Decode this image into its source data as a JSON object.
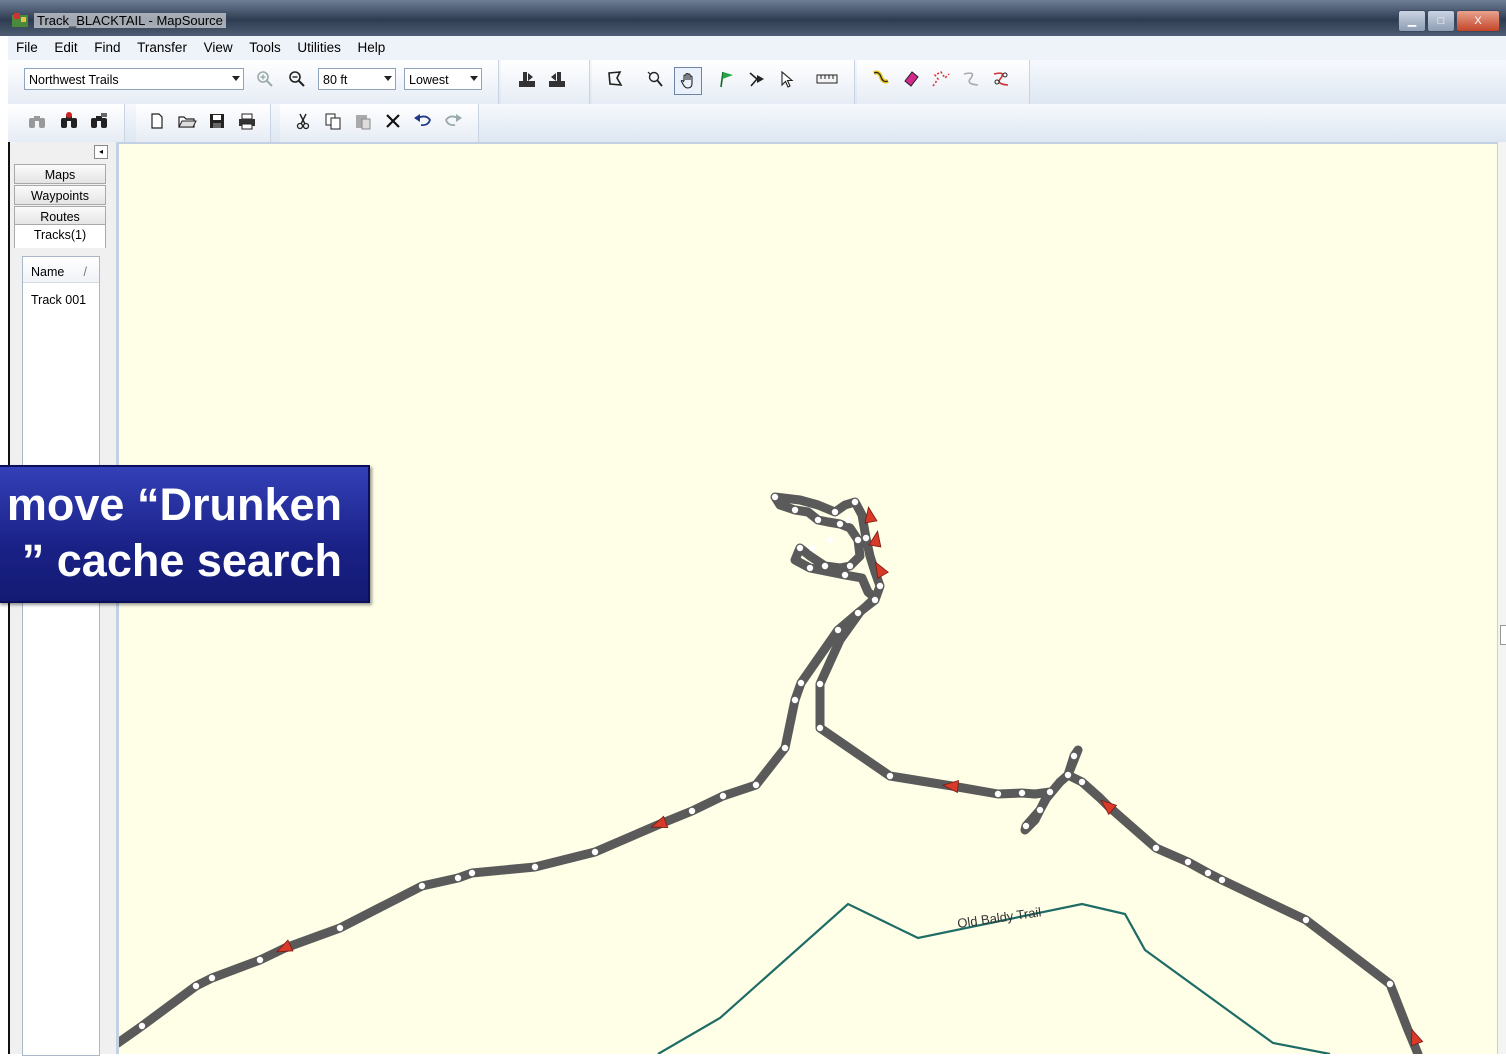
{
  "window": {
    "title": "Track_BLACKTAIL - MapSource",
    "minimize_glyph": "▁",
    "maximize_glyph": "□",
    "close_glyph": "X"
  },
  "menu": [
    "File",
    "Edit",
    "Find",
    "Transfer",
    "View",
    "Tools",
    "Utilities",
    "Help"
  ],
  "toolbar": {
    "map_product": "Northwest Trails",
    "zoom_scale": "80 ft",
    "detail_level": "Lowest"
  },
  "left_panel": {
    "tabs": [
      "Maps",
      "Waypoints",
      "Routes",
      "Tracks(1)"
    ],
    "active_tab": "Tracks(1)",
    "list_header": "Name",
    "sort_indicator": "/",
    "tracks": [
      "Track 001"
    ],
    "collapse_glyph": "◂"
  },
  "map": {
    "trail_label": "Old Baldy Trail",
    "track_color": "#5a5a5a",
    "trail_color": "#1f6b66",
    "arrow_color": "#d83a2a",
    "background": "#ffffe8"
  },
  "callout": {
    "line1": "move “Drunken",
    "line2": "” cache search"
  },
  "icons": {
    "zoom_in": "zoom-in-icon",
    "zoom_out": "zoom-out-icon",
    "hand": "pan-hand-icon"
  }
}
